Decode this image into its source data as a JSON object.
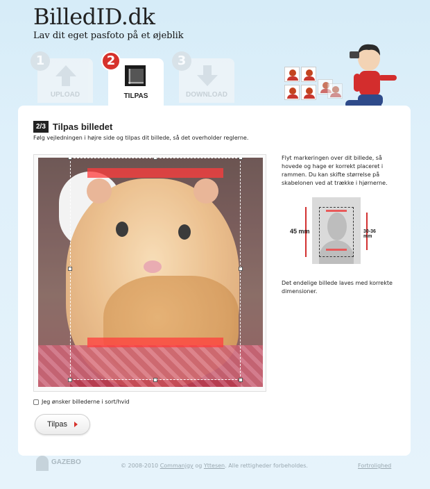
{
  "site": {
    "title": "BilledID.dk",
    "subtitle": "Lav dit eget pasfoto på et øjeblik"
  },
  "steps": [
    {
      "number": "1",
      "label": "UPLOAD",
      "state": "inactive",
      "icon": "upload-arrow-icon"
    },
    {
      "number": "2",
      "label": "TILPAS",
      "state": "active",
      "icon": "crop-icon"
    },
    {
      "number": "3",
      "label": "DOWNLOAD",
      "state": "inactive",
      "icon": "download-arrow-icon"
    }
  ],
  "main": {
    "badge": "2/3",
    "title": "Tilpas billedet",
    "intro": "Følg vejledningen i højre side og tilpas dit billede, så det overholder reglerne.",
    "help_text": "Flyt markeringen over dit billede, så hovede og hage er korrekt placeret i rammen. Du kan skifte størrelse på skabelonen ved at trække i hjørnerne.",
    "help_text2": "Det endelige billede laves med korrekte dimensioner.",
    "dimension_height": "45 mm",
    "dimension_face": "30-36 mm",
    "bw_label": "Jeg ønsker billederne i sort/hvid",
    "submit_label": "Tilpas"
  },
  "footer": {
    "brand": "GAZEBO",
    "copyright_prefix": "© 2008-2010",
    "company1": "Commanjgy",
    "connector": "og",
    "company2": "Yttesen",
    "rights": ". Alle rettigheder forbeholdes.",
    "privacy": "Fortrolighed"
  },
  "colors": {
    "accent_red": "#d6322c",
    "background": "#dff0fa",
    "card": "#ffffff"
  }
}
